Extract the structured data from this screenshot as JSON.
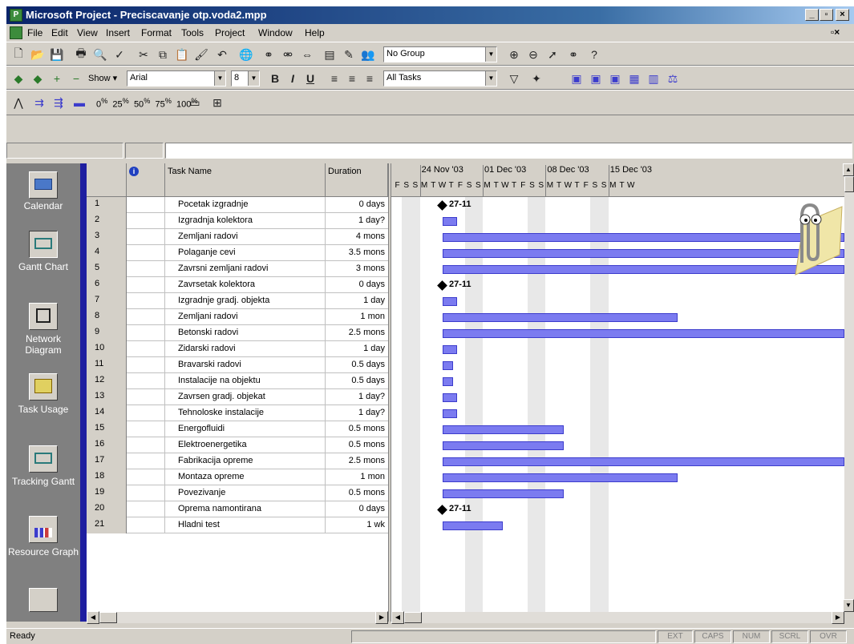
{
  "window": {
    "title": "Microsoft Project - Preciscavanje otp.voda2.mpp",
    "minimize": "_",
    "restore": "▫",
    "close": "×"
  },
  "menu": [
    "File",
    "Edit",
    "View",
    "Insert",
    "Format",
    "Tools",
    "Project",
    "Window",
    "Help"
  ],
  "toolbar": {
    "group_select": "No Group",
    "show_label": "Show",
    "font": "Arial",
    "font_size": "8",
    "bold": "B",
    "italic": "I",
    "underline": "U",
    "filter_select": "All Tasks",
    "percent_0": "0",
    "percent_25": "25",
    "percent_50": "50",
    "percent_75": "75",
    "percent_100": "100"
  },
  "viewbar": {
    "items": [
      "Calendar",
      "Gantt Chart",
      "Network Diagram",
      "Task Usage",
      "Tracking Gantt",
      "Resource Graph"
    ]
  },
  "grid": {
    "headers": {
      "id": "",
      "indicators": "",
      "task_name": "Task Name",
      "duration": "Duration"
    },
    "rows": [
      {
        "id": "1",
        "name": "Pocetak izgradnje",
        "duration": "0 days"
      },
      {
        "id": "2",
        "name": "Izgradnja kolektora",
        "duration": "1 day?"
      },
      {
        "id": "3",
        "name": "Zemljani radovi",
        "duration": "4 mons"
      },
      {
        "id": "4",
        "name": "Polaganje cevi",
        "duration": "3.5 mons"
      },
      {
        "id": "5",
        "name": "Zavrsni zemljani radovi",
        "duration": "3 mons"
      },
      {
        "id": "6",
        "name": "Zavrsetak kolektora",
        "duration": "0 days"
      },
      {
        "id": "7",
        "name": "Izgradnje gradj. objekta",
        "duration": "1 day"
      },
      {
        "id": "8",
        "name": "Zemljani radovi",
        "duration": "1 mon"
      },
      {
        "id": "9",
        "name": "Betonski radovi",
        "duration": "2.5 mons"
      },
      {
        "id": "10",
        "name": "Zidarski radovi",
        "duration": "1 day"
      },
      {
        "id": "11",
        "name": "Bravarski radovi",
        "duration": "0.5 days"
      },
      {
        "id": "12",
        "name": "Instalacije na objektu",
        "duration": "0.5 days"
      },
      {
        "id": "13",
        "name": "Zavrsen gradj. objekat",
        "duration": "1 day?"
      },
      {
        "id": "14",
        "name": "Tehnoloske instalacije",
        "duration": "1 day?"
      },
      {
        "id": "15",
        "name": "Energofluidi",
        "duration": "0.5 mons"
      },
      {
        "id": "16",
        "name": "Elektroenergetika",
        "duration": "0.5 mons"
      },
      {
        "id": "17",
        "name": "Fabrikacija opreme",
        "duration": "2.5 mons"
      },
      {
        "id": "18",
        "name": "Montaza opreme",
        "duration": "1 mon"
      },
      {
        "id": "19",
        "name": "Povezivanje",
        "duration": "0.5 mons"
      },
      {
        "id": "20",
        "name": "Oprema namontirana",
        "duration": "0 days"
      },
      {
        "id": "21",
        "name": "Hladni test",
        "duration": "1 wk"
      }
    ]
  },
  "gantt": {
    "weeks": [
      "24 Nov '03",
      "01 Dec '03",
      "08 Dec '03",
      "15 Dec '03"
    ],
    "days": [
      "F",
      "S",
      "S",
      "M",
      "T",
      "W",
      "T",
      "F",
      "S",
      "S",
      "M",
      "T",
      "W",
      "T",
      "F",
      "S",
      "S",
      "M",
      "T",
      "W",
      "T",
      "F",
      "S",
      "S",
      "M",
      "T",
      "W"
    ],
    "milestone_label": "27-11",
    "bar_color": "#7b7bf0",
    "tasks": [
      {
        "row": 0,
        "type": "milestone",
        "label": "27-11"
      },
      {
        "row": 1,
        "type": "bar",
        "start_day": 0,
        "len_days": 1
      },
      {
        "row": 2,
        "type": "bar",
        "start_day": 0,
        "len_days": 120
      },
      {
        "row": 3,
        "type": "bar",
        "start_day": 0,
        "len_days": 105
      },
      {
        "row": 4,
        "type": "bar",
        "start_day": 0,
        "len_days": 90
      },
      {
        "row": 5,
        "type": "milestone",
        "label": "27-11"
      },
      {
        "row": 6,
        "type": "bar",
        "start_day": 0,
        "len_days": 1
      },
      {
        "row": 7,
        "type": "bar",
        "start_day": 0,
        "len_days": 30
      },
      {
        "row": 8,
        "type": "bar",
        "start_day": 0,
        "len_days": 75
      },
      {
        "row": 9,
        "type": "bar",
        "start_day": 0,
        "len_days": 1
      },
      {
        "row": 10,
        "type": "bar",
        "start_day": 0,
        "len_days": 0.5
      },
      {
        "row": 11,
        "type": "bar",
        "start_day": 0,
        "len_days": 0.5
      },
      {
        "row": 12,
        "type": "bar",
        "start_day": 0,
        "len_days": 1
      },
      {
        "row": 13,
        "type": "bar",
        "start_day": 0,
        "len_days": 1
      },
      {
        "row": 14,
        "type": "bar",
        "start_day": 0,
        "len_days": 15
      },
      {
        "row": 15,
        "type": "bar",
        "start_day": 0,
        "len_days": 15
      },
      {
        "row": 16,
        "type": "bar",
        "start_day": 0,
        "len_days": 75
      },
      {
        "row": 17,
        "type": "bar",
        "start_day": 0,
        "len_days": 30
      },
      {
        "row": 18,
        "type": "bar",
        "start_day": 0,
        "len_days": 15
      },
      {
        "row": 19,
        "type": "milestone",
        "label": "27-11"
      },
      {
        "row": 20,
        "type": "bar",
        "start_day": 0,
        "len_days": 7
      }
    ]
  },
  "status": {
    "text": "Ready",
    "indicators": [
      "EXT",
      "CAPS",
      "NUM",
      "SCRL",
      "OVR"
    ]
  }
}
